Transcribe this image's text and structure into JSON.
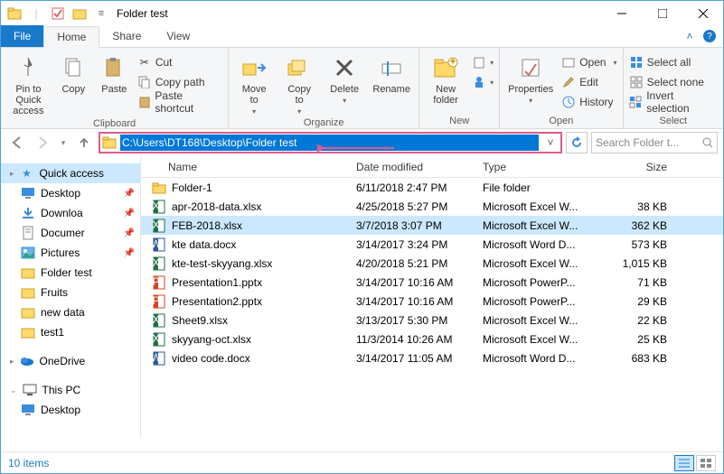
{
  "window": {
    "title": "Folder test"
  },
  "tabs": {
    "file": "File",
    "home": "Home",
    "share": "Share",
    "view": "View"
  },
  "ribbon": {
    "clipboard": {
      "label": "Clipboard",
      "pin": "Pin to Quick\naccess",
      "copy": "Copy",
      "paste": "Paste",
      "cut": "Cut",
      "copypath": "Copy path",
      "pasteshortcut": "Paste shortcut"
    },
    "organize": {
      "label": "Organize",
      "moveto": "Move\nto",
      "copyto": "Copy\nto",
      "delete": "Delete",
      "rename": "Rename"
    },
    "new": {
      "label": "New",
      "newfolder": "New\nfolder"
    },
    "open": {
      "label": "Open",
      "properties": "Properties",
      "open": "Open",
      "edit": "Edit",
      "history": "History"
    },
    "select": {
      "label": "Select",
      "selectall": "Select all",
      "selectnone": "Select none",
      "invert": "Invert selection"
    }
  },
  "address": {
    "path": "C:\\Users\\DT168\\Desktop\\Folder test",
    "search_placeholder": "Search Folder t..."
  },
  "sidebar": {
    "quick": "Quick access",
    "desktop": "Desktop",
    "downloads": "Downloa",
    "documents": "Documer",
    "pictures": "Pictures",
    "foldertest": "Folder test",
    "fruits": "Fruits",
    "newdata": "new data",
    "test1": "test1",
    "onedrive": "OneDrive",
    "thispc": "This PC",
    "desktop2": "Desktop"
  },
  "columns": {
    "name": "Name",
    "date": "Date modified",
    "type": "Type",
    "size": "Size"
  },
  "files": [
    {
      "icon": "folder",
      "name": "Folder-1",
      "date": "6/11/2018 2:47 PM",
      "type": "File folder",
      "size": ""
    },
    {
      "icon": "xlsx",
      "name": "apr-2018-data.xlsx",
      "date": "4/25/2018 5:27 PM",
      "type": "Microsoft Excel W...",
      "size": "38 KB"
    },
    {
      "icon": "xlsx",
      "name": "FEB-2018.xlsx",
      "date": "3/7/2018 3:07 PM",
      "type": "Microsoft Excel W...",
      "size": "362 KB",
      "selected": true
    },
    {
      "icon": "docx",
      "name": "kte data.docx",
      "date": "3/14/2017 3:24 PM",
      "type": "Microsoft Word D...",
      "size": "573 KB"
    },
    {
      "icon": "xlsx",
      "name": "kte-test-skyyang.xlsx",
      "date": "4/20/2018 5:21 PM",
      "type": "Microsoft Excel W...",
      "size": "1,015 KB"
    },
    {
      "icon": "pptx",
      "name": "Presentation1.pptx",
      "date": "3/14/2017 10:16 AM",
      "type": "Microsoft PowerP...",
      "size": "71 KB"
    },
    {
      "icon": "pptx",
      "name": "Presentation2.pptx",
      "date": "3/14/2017 10:16 AM",
      "type": "Microsoft PowerP...",
      "size": "29 KB"
    },
    {
      "icon": "xlsx",
      "name": "Sheet9.xlsx",
      "date": "3/13/2017 5:30 PM",
      "type": "Microsoft Excel W...",
      "size": "22 KB"
    },
    {
      "icon": "xlsx",
      "name": "skyyang-oct.xlsx",
      "date": "11/3/2014 10:26 AM",
      "type": "Microsoft Excel W...",
      "size": "25 KB"
    },
    {
      "icon": "docx",
      "name": "video code.docx",
      "date": "3/14/2017 11:05 AM",
      "type": "Microsoft Word D...",
      "size": "683 KB"
    }
  ],
  "status": {
    "count": "10 items"
  }
}
